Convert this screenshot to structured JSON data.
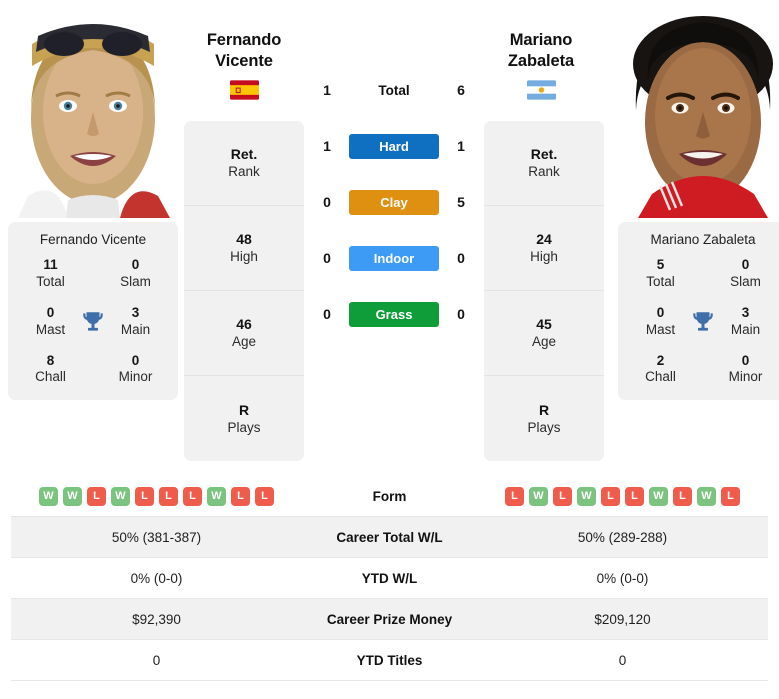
{
  "players": {
    "left": {
      "first_name": "Fernando",
      "last_name": "Vicente",
      "full_name": "Fernando Vicente",
      "country": "Spain",
      "flag_icon": "flag-spain-icon",
      "info": [
        {
          "value": "Ret.",
          "label": "Rank"
        },
        {
          "value": "48",
          "label": "High"
        },
        {
          "value": "46",
          "label": "Age"
        },
        {
          "value": "R",
          "label": "Plays"
        }
      ],
      "titles": [
        {
          "value": "11",
          "label": "Total"
        },
        {
          "value": "0",
          "label": "Slam"
        },
        {
          "value": "0",
          "label": "Mast"
        },
        {
          "value": "3",
          "label": "Main"
        },
        {
          "value": "8",
          "label": "Chall"
        },
        {
          "value": "0",
          "label": "Minor"
        }
      ],
      "form": [
        "W",
        "W",
        "L",
        "W",
        "L",
        "L",
        "L",
        "W",
        "L",
        "L"
      ],
      "career_total_wl": "50% (381-387)",
      "ytd_wl": "0% (0-0)",
      "career_prize_money": "$92,390",
      "ytd_titles": "0",
      "h2h": {
        "total": "1",
        "hard": "1",
        "clay": "0",
        "indoor": "0",
        "grass": "0"
      }
    },
    "right": {
      "first_name": "Mariano",
      "last_name": "Zabaleta",
      "full_name": "Mariano Zabaleta",
      "country": "Argentina",
      "flag_icon": "flag-argentina-icon",
      "info": [
        {
          "value": "Ret.",
          "label": "Rank"
        },
        {
          "value": "24",
          "label": "High"
        },
        {
          "value": "45",
          "label": "Age"
        },
        {
          "value": "R",
          "label": "Plays"
        }
      ],
      "titles": [
        {
          "value": "5",
          "label": "Total"
        },
        {
          "value": "0",
          "label": "Slam"
        },
        {
          "value": "0",
          "label": "Mast"
        },
        {
          "value": "3",
          "label": "Main"
        },
        {
          "value": "2",
          "label": "Chall"
        },
        {
          "value": "0",
          "label": "Minor"
        }
      ],
      "form": [
        "L",
        "W",
        "L",
        "W",
        "L",
        "L",
        "W",
        "L",
        "W",
        "L"
      ],
      "career_total_wl": "50% (289-288)",
      "ytd_wl": "0% (0-0)",
      "career_prize_money": "$209,120",
      "ytd_titles": "0",
      "h2h": {
        "total": "6",
        "hard": "1",
        "clay": "5",
        "indoor": "0",
        "grass": "0"
      }
    }
  },
  "surfaces": [
    {
      "key": "total",
      "label": "Total",
      "left": "1",
      "right": "6",
      "color": "",
      "is_pill": false
    },
    {
      "key": "hard",
      "label": "Hard",
      "left": "1",
      "right": "1",
      "color": "#0f6fc0",
      "is_pill": true
    },
    {
      "key": "clay",
      "label": "Clay",
      "left": "0",
      "right": "5",
      "color": "#e09010",
      "is_pill": true
    },
    {
      "key": "indoor",
      "label": "Indoor",
      "left": "0",
      "right": "0",
      "color": "#3d9bf5",
      "is_pill": true
    },
    {
      "key": "grass",
      "label": "Grass",
      "left": "0",
      "right": "0",
      "color": "#0f9d3a",
      "is_pill": true
    }
  ],
  "comparison_rows": [
    {
      "key": "form",
      "label": "Form",
      "type": "form",
      "shaded": false
    },
    {
      "key": "career_total_wl",
      "label": "Career Total W/L",
      "type": "text",
      "shaded": true,
      "left": "50% (381-387)",
      "right": "50% (289-288)"
    },
    {
      "key": "ytd_wl",
      "label": "YTD W/L",
      "type": "text",
      "shaded": false,
      "left": "0% (0-0)",
      "right": "0% (0-0)"
    },
    {
      "key": "career_prize_money",
      "label": "Career Prize Money",
      "type": "text",
      "shaded": true,
      "left": "$92,390",
      "right": "$209,120"
    },
    {
      "key": "ytd_titles",
      "label": "YTD Titles",
      "type": "text",
      "shaded": false,
      "left": "0",
      "right": "0"
    }
  ],
  "icons": {
    "trophy": "trophy-icon"
  },
  "colors": {
    "hard": "#0f6fc0",
    "clay": "#e09010",
    "indoor": "#3d9bf5",
    "grass": "#0f9d3a",
    "win_badge": "#7ac47f",
    "loss_badge": "#ef5c4c",
    "card_bg": "#f1f1f1",
    "trophy_blue": "#3f6fa8"
  }
}
